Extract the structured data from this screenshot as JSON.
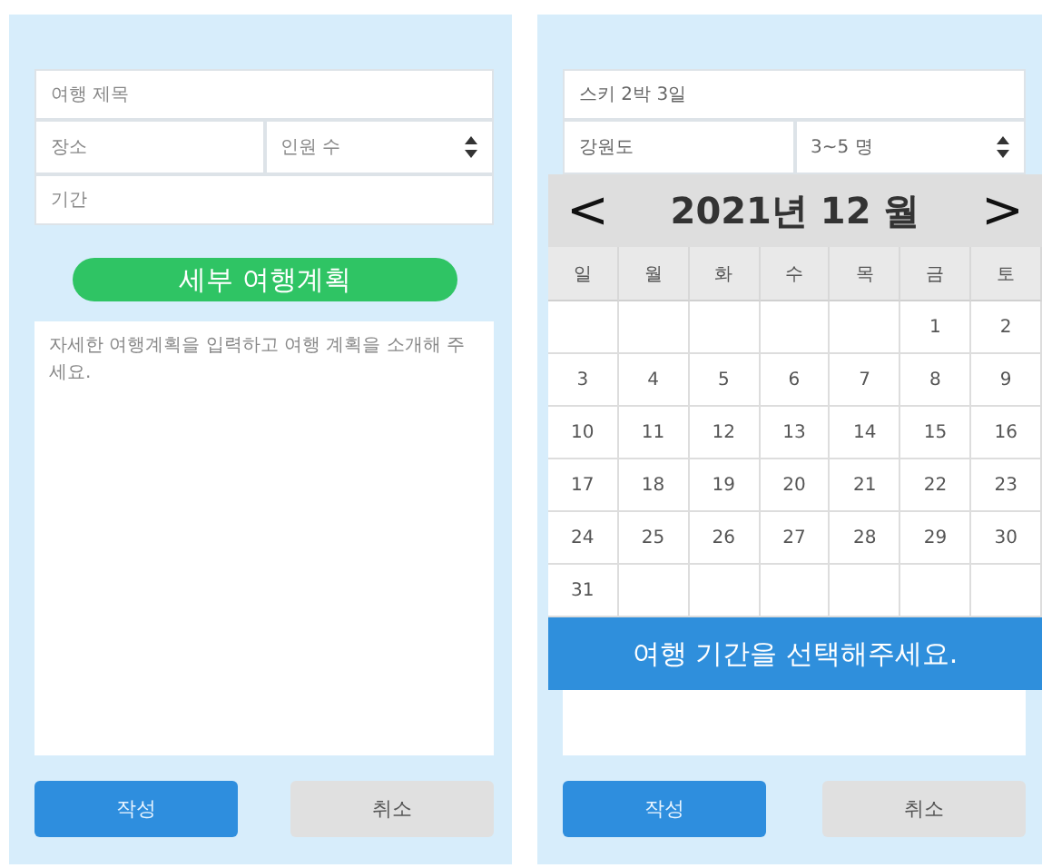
{
  "screens": [
    {
      "fields": {
        "title": {
          "placeholder": "여행 제목"
        },
        "location": {
          "placeholder": "장소"
        },
        "people": {
          "placeholder": "인원 수"
        },
        "period": {
          "placeholder": "기간"
        }
      },
      "section_button": "세부 여행계획",
      "description": {
        "placeholder": "자세한 여행계획을 입력하고 여행 계획을 소개해 주세요."
      },
      "buttons": [
        {
          "label": "작성",
          "kind": "primary"
        },
        {
          "label": "취소",
          "kind": "secondary"
        }
      ]
    },
    {
      "fields": {
        "title": {
          "value": "스키 2박 3일"
        },
        "location": {
          "value": "강원도"
        },
        "people": {
          "value": "3~5 명"
        }
      },
      "buttons": [
        {
          "label": "작성",
          "kind": "primary"
        },
        {
          "label": "취소",
          "kind": "secondary"
        }
      ],
      "calendar": {
        "prev": "<",
        "title": "2021년 12 월",
        "next": ">",
        "weekdays": [
          "일",
          "월",
          "화",
          "수",
          "목",
          "금",
          "토"
        ],
        "weeks": [
          {
            "kind": "first",
            "days": [
              "1",
              "2"
            ]
          },
          {
            "kind": "full",
            "days": [
              "3",
              "4",
              "5",
              "6",
              "7",
              "8",
              "9"
            ]
          },
          {
            "kind": "full",
            "days": [
              "10",
              "11",
              "12",
              "13",
              "14",
              "15",
              "16"
            ]
          },
          {
            "kind": "full",
            "days": [
              "17",
              "18",
              "19",
              "20",
              "21",
              "22",
              "23"
            ]
          },
          {
            "kind": "full",
            "days": [
              "24",
              "25",
              "26",
              "27",
              "28",
              "29",
              "30"
            ]
          },
          {
            "kind": "last",
            "days": [
              "31"
            ]
          }
        ],
        "message": "여행 기간을 선택해주세요."
      }
    }
  ]
}
